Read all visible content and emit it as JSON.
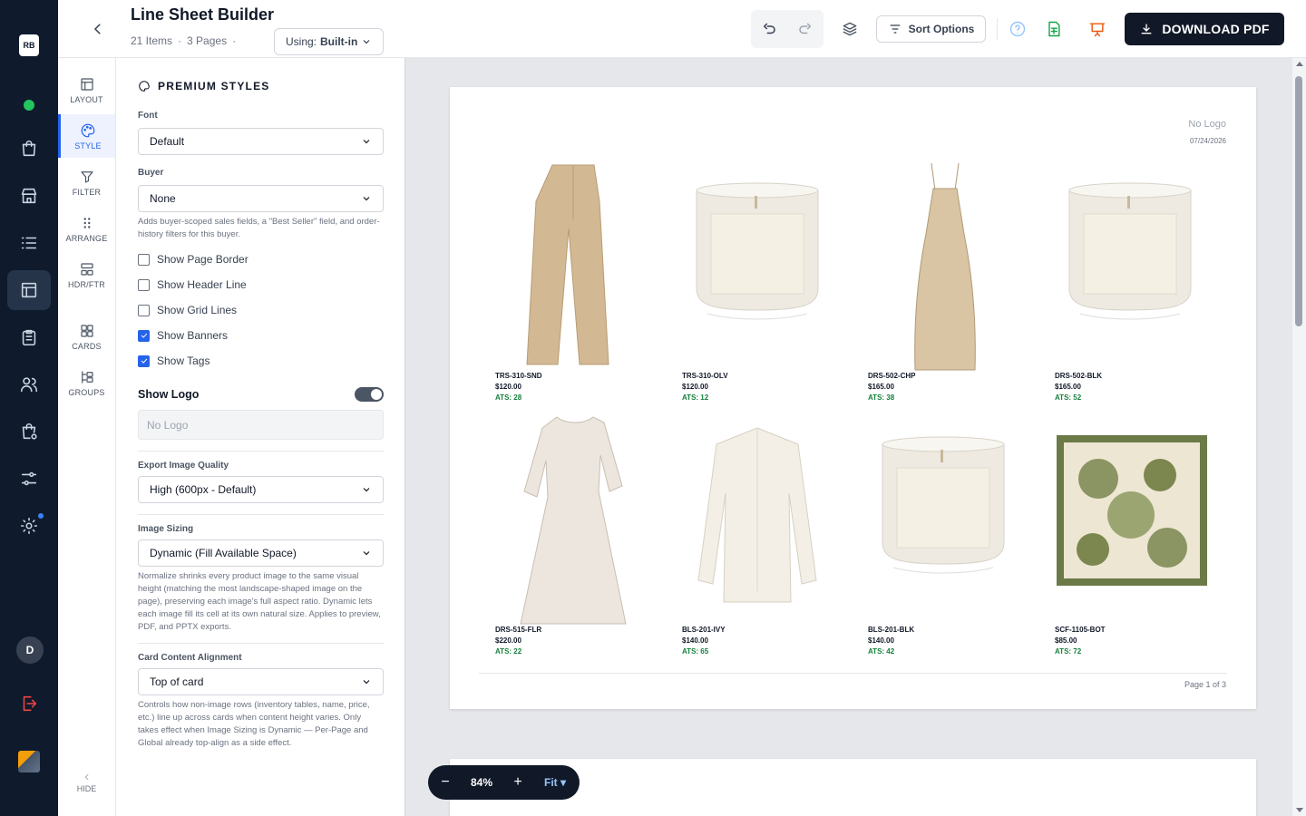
{
  "rail": {
    "badge": "RB",
    "user_initial": "D"
  },
  "header": {
    "title": "Line Sheet Builder",
    "items": "21 Items",
    "pages": "3 Pages",
    "using_label": "Using:",
    "using_value": "Built-in",
    "sort_label": "Sort Options",
    "download_label": "DOWNLOAD PDF"
  },
  "tools": [
    {
      "label": "LAYOUT",
      "icon": "layout-icon"
    },
    {
      "label": "STYLE",
      "icon": "palette-icon",
      "active": true
    },
    {
      "label": "FILTER",
      "icon": "filter-icon"
    },
    {
      "label": "ARRANGE",
      "icon": "drag-dots-icon"
    },
    {
      "label": "HDR/FTR",
      "icon": "header-footer-icon"
    },
    {
      "label": "CARDS",
      "icon": "cards-grid-icon"
    },
    {
      "label": "GROUPS",
      "icon": "groups-icon"
    }
  ],
  "hide_label": "HIDE",
  "panel": {
    "heading": "PREMIUM STYLES",
    "font_label": "Font",
    "font_value": "Default",
    "buyer_label": "Buyer",
    "buyer_value": "None",
    "buyer_help": "Adds buyer-scoped sales fields, a \"Best Seller\" field, and order-history filters for this buyer.",
    "checks": [
      {
        "label": "Show Page Border",
        "checked": false
      },
      {
        "label": "Show Header Line",
        "checked": false
      },
      {
        "label": "Show Grid Lines",
        "checked": false
      },
      {
        "label": "Show Banners",
        "checked": true
      },
      {
        "label": "Show Tags",
        "checked": true
      }
    ],
    "show_logo_label": "Show Logo",
    "show_logo_on": true,
    "logo_placeholder": "No Logo",
    "export_label": "Export Image Quality",
    "export_value": "High (600px - Default)",
    "sizing_label": "Image Sizing",
    "sizing_value": "Dynamic (Fill Available Space)",
    "sizing_help": "Normalize shrinks every product image to the same visual height (matching the most landscape-shaped image on the page), preserving each image's full aspect ratio. Dynamic lets each image fill its cell at its own natural size. Applies to preview, PDF, and PPTX exports.",
    "align_label": "Card Content Alignment",
    "align_value": "Top of card",
    "align_help": "Controls how non-image rows (inventory tables, name, price, etc.) line up across cards when content height varies. Only takes effect when Image Sizing is Dynamic — Per-Page and Global already top-align as a side effect."
  },
  "page": {
    "logo_text": "No Logo",
    "date": "07/24/2026",
    "page_label": "Page 1 of 3",
    "products": [
      {
        "sku": "TRS-310-SND",
        "price": "$120.00",
        "ats": "ATS: 28",
        "kind": "pants",
        "color": "#d2b893"
      },
      {
        "sku": "TRS-310-OLV",
        "price": "$120.00",
        "ats": "ATS: 12",
        "kind": "candle",
        "color": "#f5f0e4"
      },
      {
        "sku": "DRS-502-CHP",
        "price": "$165.00",
        "ats": "ATS: 38",
        "kind": "slipdress",
        "color": "#d9c4a3"
      },
      {
        "sku": "DRS-502-BLK",
        "price": "$165.00",
        "ats": "ATS: 52",
        "kind": "candle",
        "color": "#f5f0e4"
      },
      {
        "sku": "DRS-515-FLR",
        "price": "$220.00",
        "ats": "ATS: 22",
        "kind": "floraldress",
        "color": "#ece6de"
      },
      {
        "sku": "BLS-201-IVY",
        "price": "$140.00",
        "ats": "ATS: 65",
        "kind": "blouse",
        "color": "#f3efe6"
      },
      {
        "sku": "BLS-201-BLK",
        "price": "$140.00",
        "ats": "ATS: 42",
        "kind": "candle",
        "color": "#f5f0e4"
      },
      {
        "sku": "SCF-1105-BOT",
        "price": "$85.00",
        "ats": "ATS: 72",
        "kind": "scarf",
        "color": "#6b7a46"
      }
    ]
  },
  "zoom": {
    "minus": "−",
    "value": "84%",
    "plus": "+",
    "fit": "Fit"
  }
}
